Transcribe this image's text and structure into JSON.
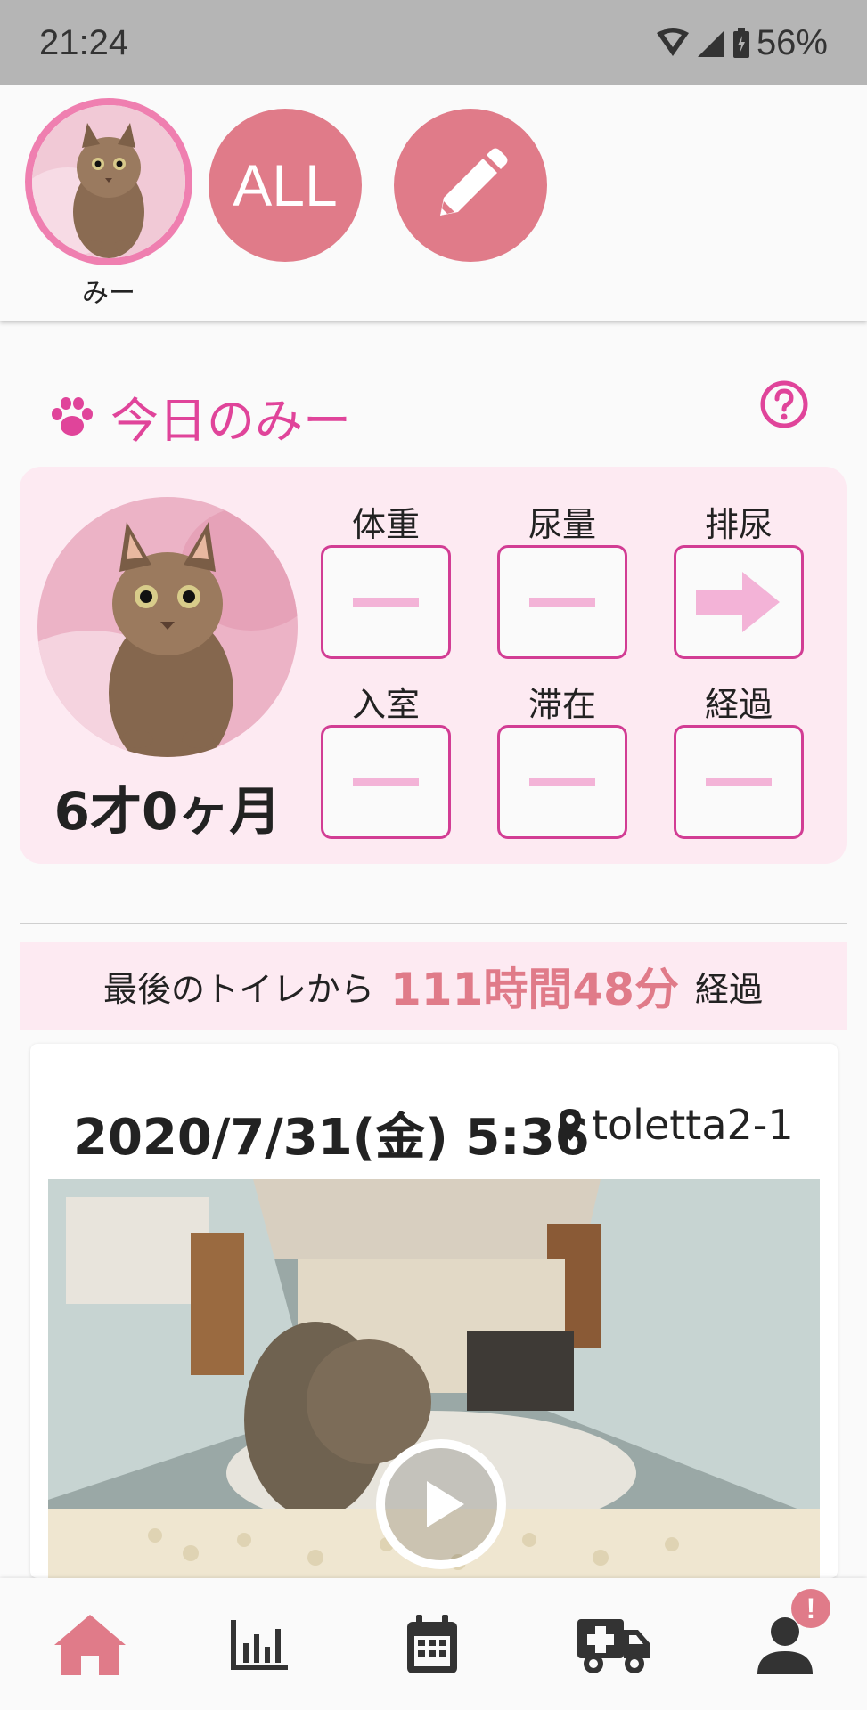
{
  "status_bar": {
    "time": "21:24",
    "battery": "56%"
  },
  "pet_selector": {
    "pets": [
      {
        "name": "みー"
      }
    ],
    "all_label": "ALL"
  },
  "today": {
    "title": "今日のみー",
    "age": "6才0ヶ月",
    "metrics": [
      {
        "label": "体重",
        "value": "—"
      },
      {
        "label": "尿量",
        "value": "—"
      },
      {
        "label": "排尿",
        "value": "→"
      },
      {
        "label": "入室",
        "value": "—"
      },
      {
        "label": "滞在",
        "value": "—"
      },
      {
        "label": "経過",
        "value": "—"
      }
    ]
  },
  "elapsed": {
    "prefix": "最後のトイレから",
    "duration": "111時間48分",
    "suffix": "経過"
  },
  "record": {
    "datetime": "2020/7/31(金) 5:36",
    "location": "toletta2-1"
  },
  "bottom_nav": {
    "items": [
      {
        "icon": "home-icon",
        "active": true
      },
      {
        "icon": "chart-icon"
      },
      {
        "icon": "calendar-icon"
      },
      {
        "icon": "ambulance-icon"
      },
      {
        "icon": "profile-icon",
        "badge": "!"
      }
    ]
  },
  "colors": {
    "accent_pink": "#e0449a",
    "button_rose": "#e07b89",
    "card_bg": "#fdeaf2"
  }
}
